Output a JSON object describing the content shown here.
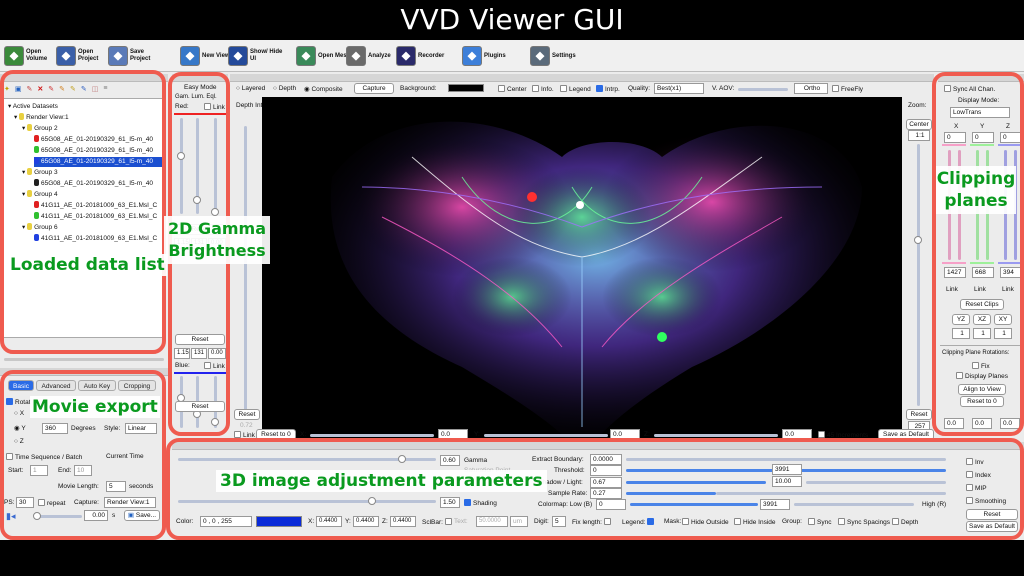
{
  "title": "VVD Viewer GUI",
  "toolbar": [
    {
      "label": "Open Volume",
      "icon": "open-volume-icon",
      "color": "#3b8a3b"
    },
    {
      "label": "Open Project",
      "icon": "open-project-icon",
      "color": "#3a5fa8"
    },
    {
      "label": "Save Project",
      "icon": "save-project-icon",
      "color": "#5a7ab8"
    },
    {
      "label": "New View",
      "icon": "new-view-icon",
      "color": "#3778c8"
    },
    {
      "label": "Show/ Hide UI",
      "icon": "show-hide-ui-icon",
      "color": "#244a9a"
    },
    {
      "label": "Open Mesh",
      "icon": "open-mesh-icon",
      "color": "#3a8a5a"
    },
    {
      "label": "Analyze",
      "icon": "analyze-icon",
      "color": "#6a6a6a"
    },
    {
      "label": "Recorder",
      "icon": "recorder-icon",
      "color": "#2a2a6a"
    },
    {
      "label": "Plugins",
      "icon": "plugins-icon",
      "color": "#3d7fd9"
    },
    {
      "label": "Settings",
      "icon": "settings-icon",
      "color": "#5a6a7a"
    }
  ],
  "datasets": {
    "root": "Active Datasets",
    "rows": [
      {
        "label": "Render View:1",
        "level": 1,
        "color": "#e8d040",
        "selected": false
      },
      {
        "label": "Group 2",
        "level": 2,
        "color": "#e8d040",
        "selected": false
      },
      {
        "label": "65G08_AE_01-20190329_61_I5-m_40",
        "level": 3,
        "color": "#e02020",
        "selected": false
      },
      {
        "label": "65G08_AE_01-20190329_61_I5-m_40",
        "level": 3,
        "color": "#30c030",
        "selected": false
      },
      {
        "label": "65G08_AE_01-20190329_61_I5-m_40",
        "level": 3,
        "color": "#2040e0",
        "selected": true
      },
      {
        "label": "Group 3",
        "level": 2,
        "color": "#e8d040",
        "selected": false
      },
      {
        "label": "65G08_AE_01-20190329_61_I5-m_40",
        "level": 3,
        "color": "#202020",
        "selected": false
      },
      {
        "label": "Group 4",
        "level": 2,
        "color": "#e8d040",
        "selected": false
      },
      {
        "label": "41G11_AE_01-20181009_63_E1.MsI_C",
        "level": 3,
        "color": "#e02020",
        "selected": false
      },
      {
        "label": "41G11_AE_01-20181009_63_E1.MsI_C",
        "level": 3,
        "color": "#30c030",
        "selected": false
      },
      {
        "label": "Group 6",
        "level": 2,
        "color": "#e8d040",
        "selected": false
      },
      {
        "label": "41G11_AE_01-20181009_63_E1.MsI_C",
        "level": 3,
        "color": "#2040e0",
        "selected": false
      }
    ]
  },
  "annotations": {
    "loaded": "Loaded data list",
    "gamma": "2D Gamma Brightness",
    "clipping": "Clipping planes",
    "movie": "Movie export",
    "adjust": "3D image adjustment parameters"
  },
  "gamma_panel": {
    "mode": "Easy Mode",
    "cols": "Gam. Lum. Eql.",
    "red": "Red:",
    "link": "Link",
    "reset": "Reset",
    "v1": "1.15",
    "v2": "131",
    "v3": "0.00",
    "blue": "Blue:"
  },
  "render_bar": {
    "layered": "Layered",
    "depth": "Depth",
    "composite": "Composite",
    "capture": "Capture",
    "background": "Background:",
    "center": "Center",
    "info": "Info.",
    "legend": "Legend",
    "intrp": "Intrp.",
    "quality": "Quality:",
    "quality_val": "Best(x1)",
    "vaov": "V. AOV:",
    "ortho": "Ortho",
    "freefly": "FreeFly"
  },
  "depth_int": "Depth Int:",
  "zoom": {
    "label": "Zoom:",
    "center": "Center",
    "ratio": "1:1",
    "reset": "Reset",
    "value": "257"
  },
  "left_reset": "Reset",
  "left_val": "0.72",
  "bottom_bar": {
    "link": "Link",
    "reset0": "Reset to 0",
    "x": "X:",
    "xv": "0.0",
    "y": "Y:",
    "yv": "0.0",
    "z": "Z:",
    "zv": "0.0",
    "inc": "45 Increments",
    "save": "Save as Default"
  },
  "clip": {
    "sync": "Sync All Chan.",
    "display_mode": "Display Mode:",
    "mode_val": "LowTrans",
    "x": "X",
    "y": "Y",
    "z": "Z",
    "x0": "0",
    "y0": "0",
    "z0": "0",
    "x1": "1427",
    "y1": "668",
    "z1": "394",
    "link": "Link",
    "reset_clips": "Reset Clips",
    "yz": "YZ",
    "xz": "XZ",
    "xy": "XY",
    "one": "1",
    "rot_title": "Clipping Plane Rotations:",
    "fix": "Fix",
    "display_planes": "Display Planes",
    "align": "Align to View",
    "reset0": "Reset to 0",
    "r0": "0.0"
  },
  "movie": {
    "tabs": [
      "Basic",
      "Advanced",
      "Auto Key",
      "Cropping"
    ],
    "rotate": "Rotat",
    "x": "X",
    "y": "Y",
    "z": "Z",
    "deg_val": "360",
    "degrees": "Degrees",
    "style": "Style:",
    "style_val": "Linear",
    "seq": "Time Sequence / Batch",
    "current": "Current Time",
    "start": "Start:",
    "start_v": "1",
    "end": "End:",
    "end_v": "10",
    "length": "Movie Length:",
    "length_v": "5",
    "seconds": "seconds",
    "fps": "PS:",
    "fps_v": "30",
    "repeat": "repeat",
    "capture": "Capture:",
    "capture_v": "Render View:1",
    "time_v": "0.00",
    "s": "s",
    "save": "Save..."
  },
  "adjust": {
    "gamma_v": "0.60",
    "gamma": "Gamma",
    "sat": "Saturation Point",
    "shading_v": "1.50",
    "shading": "Shading",
    "extract": "Extract Boundary:",
    "extract_v": "0.0000",
    "threshold": "Threshold:",
    "thr_v": "0",
    "thr_hi": "3991",
    "shadow": "Shadow / Light:",
    "shadow_v": "0.67",
    "light_v": "10.00",
    "sample": "Sample Rate:",
    "sample_v": "0.27",
    "colormap": "Colormap: Low (B)",
    "cm_lo": "0",
    "cm_hi": "3991",
    "high": "High (R)",
    "inv": "Inv",
    "index": "Index",
    "mip": "MIP",
    "smooth": "Smoothing",
    "reset": "Reset",
    "save": "Save as Default",
    "color": "Color:",
    "color_v": "0 , 0 , 255",
    "sx": "X:",
    "sx_v": "0.4400",
    "sy": "Y:",
    "sy_v": "0.4400",
    "sz": "Z:",
    "sz_v": "0.4400",
    "sclbar": "SclBar:",
    "text": "Text:",
    "text_v": "50.0000",
    "um": "um",
    "digit": "Digit:",
    "digit_v": "5",
    "fix": "Fix length:",
    "legend": "Legend:",
    "mask": "Mask:",
    "hide_out": "Hide Outside",
    "hide_in": "Hide Inside",
    "group": "Group:",
    "sync": "Sync",
    "sync_sp": "Sync Spacings",
    "depth": "Depth",
    "swatch": "#0a2ad8"
  }
}
